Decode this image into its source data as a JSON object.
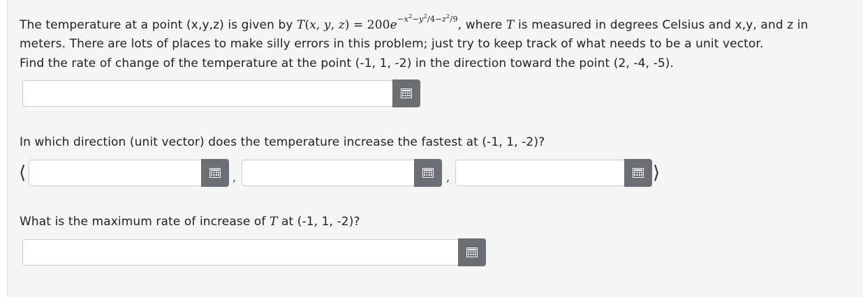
{
  "problem": {
    "line1_a": "The temperature at a point (x,y,z) is given by",
    "formula": {
      "lhs_func": "T",
      "lhs_open": "(",
      "lhs_x": "x",
      "lhs_c1": ", ",
      "lhs_y": "y",
      "lhs_c2": ", ",
      "lhs_z": "z",
      "lhs_close": ")",
      "eq": " = 200",
      "e": "e",
      "exp_1": "−",
      "exp_x": "x",
      "exp_2": "2",
      "exp_3": "−",
      "exp_y": "y",
      "exp_4": "2",
      "exp_5": "/4−",
      "exp_z": "z",
      "exp_6": "2",
      "exp_7": "/9"
    },
    "line1_b": ", where",
    "T_symbol": "T",
    "line1_c": "is measured in degrees Celsius and x,y, and z in",
    "line2": "meters. There are lots of places to make silly errors in this problem; just try to keep track of what needs to be a unit vector.",
    "line3": "Find the rate of change of the temperature at the point (-1, 1, -2) in the direction toward the point (2, -4, -5)."
  },
  "q2": {
    "label": "In which direction (unit vector) does the temperature increase the fastest at (-1, 1, -2)?"
  },
  "q3": {
    "label_a": "What is the maximum rate of increase of",
    "T_symbol": "T",
    "label_b": "at (-1, 1, -2)?"
  },
  "vector": {
    "open": "⟨",
    "comma": ",",
    "close": "⟩"
  },
  "inputs": {
    "answer1": "",
    "vec_x": "",
    "vec_y": "",
    "vec_z": "",
    "answer3": ""
  },
  "icons": {
    "keypad": "keypad-icon"
  },
  "colors": {
    "keypad_button": "#6b6f73",
    "panel_bg": "#f5f5f5",
    "text": "#222222"
  }
}
